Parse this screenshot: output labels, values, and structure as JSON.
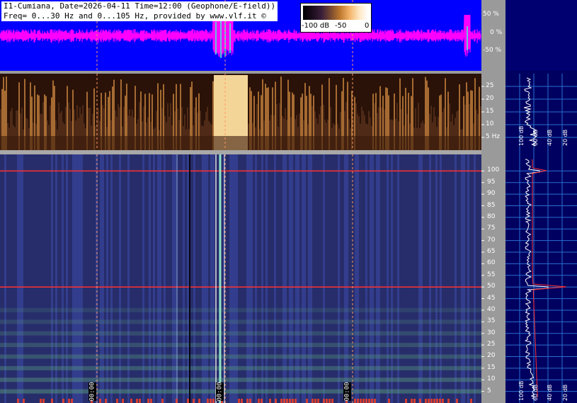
{
  "header": {
    "line1": "I1-Cumiana, Date=2026-04-11 Time=12:00 (Geophone/E-field))",
    "line2": "Freq= 0...30 Hz and 0...105 Hz, provided by www.vlf.it ©"
  },
  "colorbar": {
    "labels": [
      "-100 dB",
      "-50",
      "0"
    ]
  },
  "waveform": {
    "tick_labels": [
      "50 %",
      "0 %",
      "-50 %"
    ],
    "colors": {
      "background": "#0000ff",
      "trace": "#ff00ff",
      "burst": "#33ffcc"
    }
  },
  "time_markers": [
    "00:00",
    "00:00",
    "00:00"
  ],
  "spectrum_panels": {
    "right_units": [
      "100 dB",
      "60 dB",
      "40 dB",
      "20 dB"
    ]
  },
  "chart_data": [
    {
      "type": "line",
      "name": "waveform",
      "y_axis": {
        "ticks": [
          50,
          0,
          -50
        ],
        "unit": "%"
      }
    },
    {
      "type": "heatmap",
      "name": "spectrogram-low",
      "y_axis": {
        "ticks": [
          25,
          20,
          15,
          10,
          5
        ],
        "tick_labels": [
          "25",
          "20",
          "15",
          "10",
          "5 Hz"
        ],
        "range": [
          0,
          30
        ]
      },
      "colors": {
        "low": "#2a1208",
        "high": "#ffd080"
      }
    },
    {
      "type": "heatmap",
      "name": "spectrogram-high",
      "y_axis": {
        "ticks": [
          100,
          95,
          90,
          85,
          80,
          75,
          70,
          65,
          60,
          55,
          50,
          45,
          40,
          35,
          30,
          25,
          20,
          15,
          10,
          5
        ],
        "range": [
          0,
          105
        ]
      },
      "emission_lines_hz": [
        100,
        50
      ],
      "colors": {
        "background": "#2a3070",
        "line": "#ff3030",
        "low_band": "#5aa080"
      }
    },
    {
      "type": "line",
      "name": "average-spectrum-high",
      "x_axis": {
        "tick_labels": [
          "100 dB",
          "60 dB",
          "40 dB",
          "20 dB"
        ]
      },
      "peaks_hz": [
        100,
        50
      ]
    }
  ]
}
